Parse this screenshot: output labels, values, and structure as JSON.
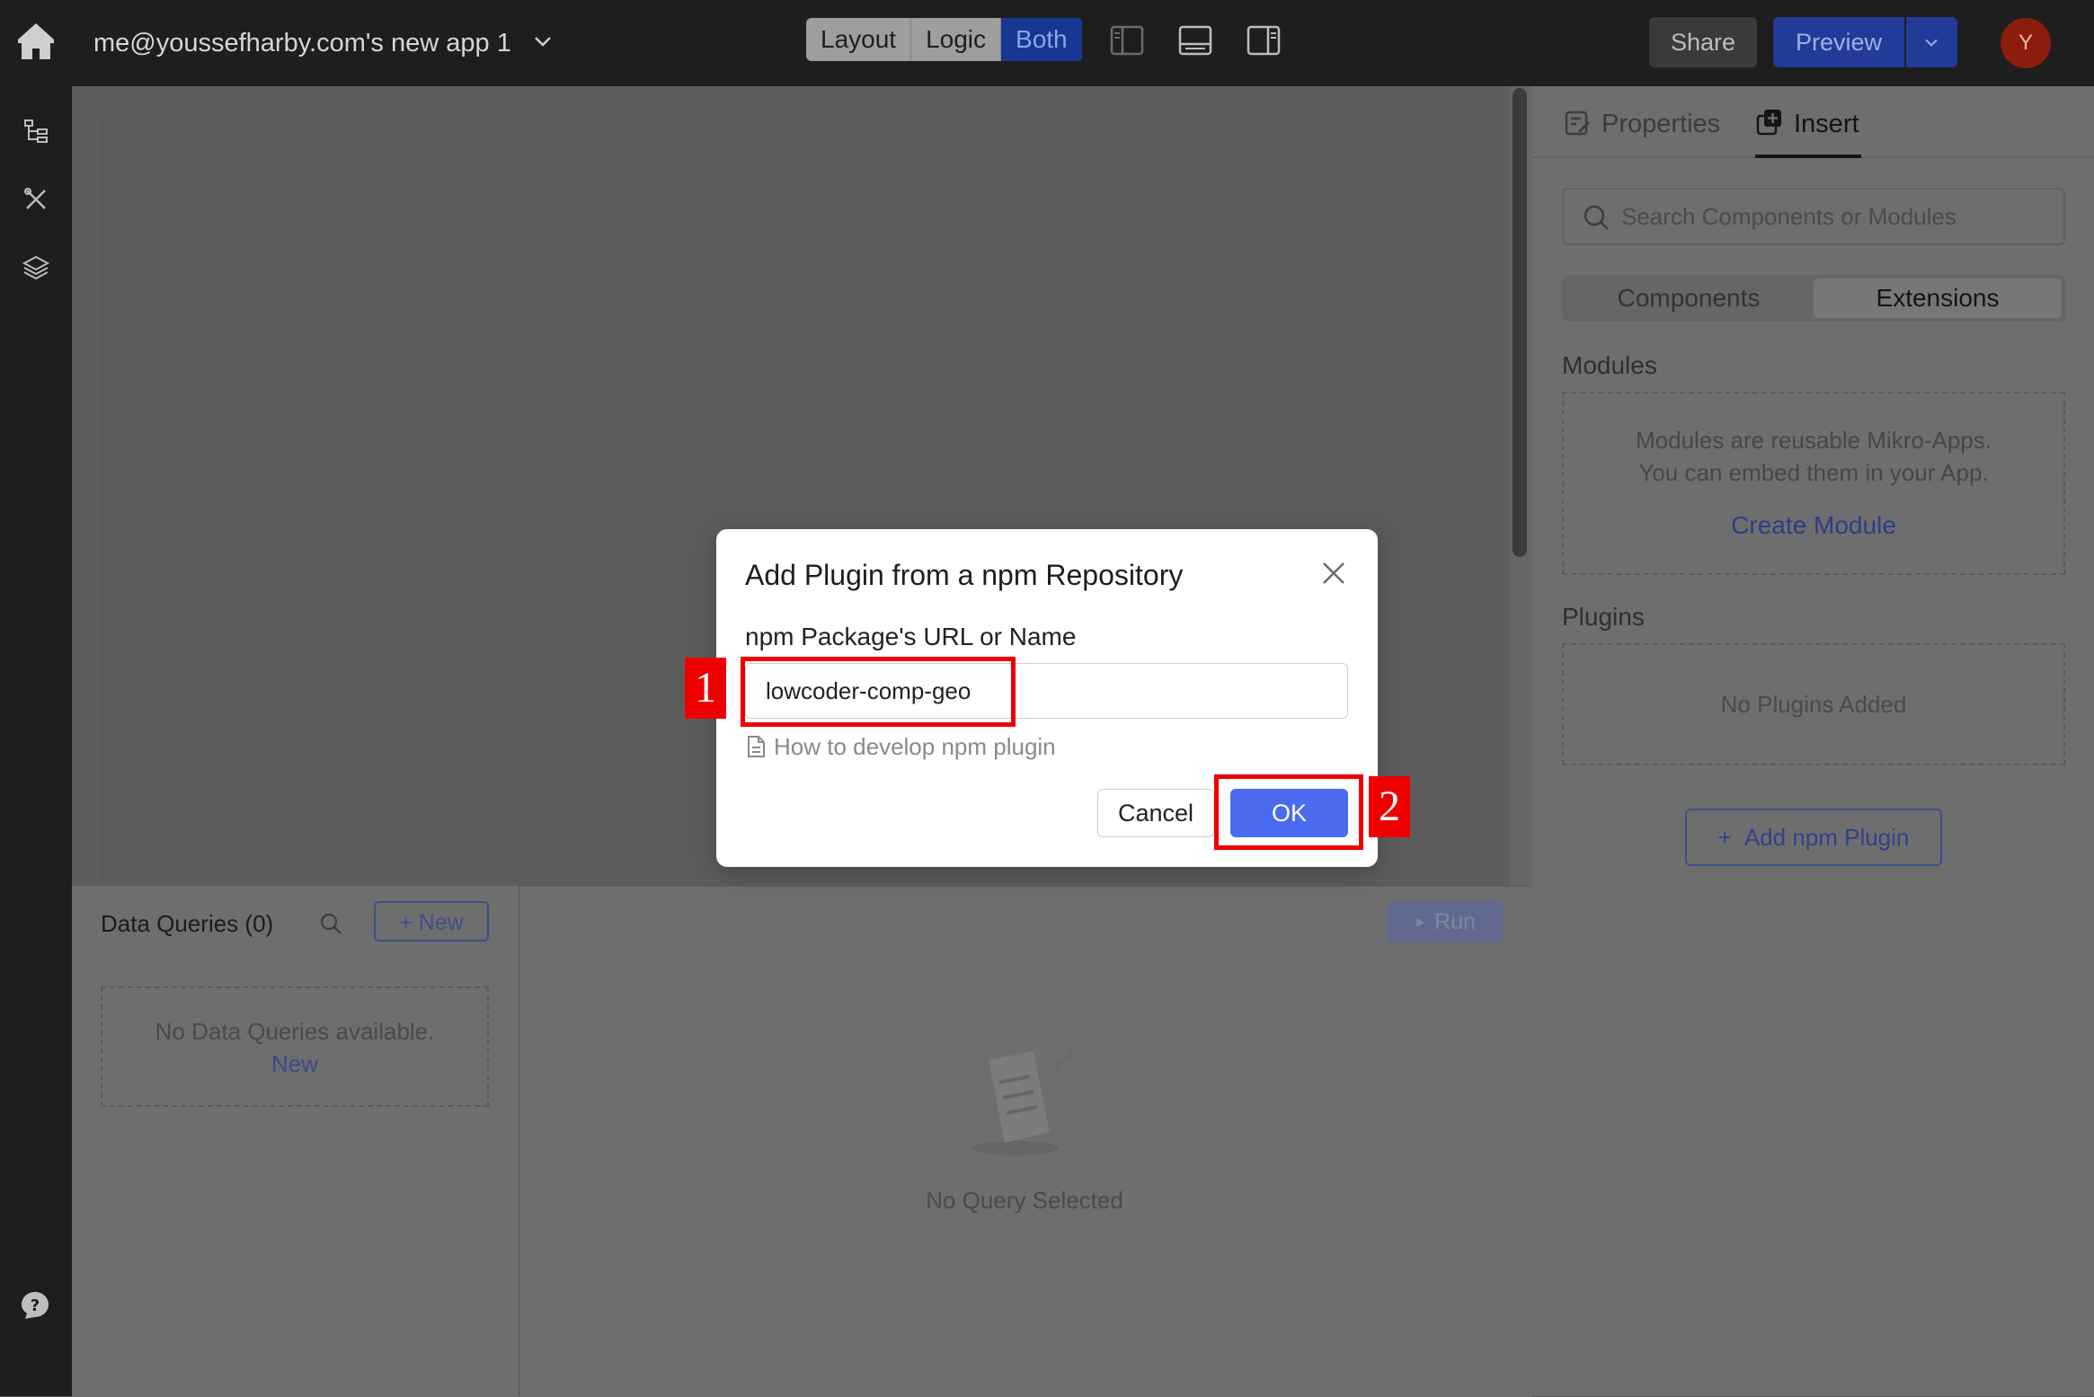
{
  "header": {
    "app_title": "me@youssefharby.com's new app 1",
    "modes": [
      "Layout",
      "Logic",
      "Both"
    ],
    "active_mode": "Both",
    "share_label": "Share",
    "preview_label": "Preview",
    "avatar_initial": "Y"
  },
  "left_sidebar": {
    "icons": [
      "tree-icon",
      "tools-icon",
      "layers-icon"
    ],
    "help_icon": "help-icon"
  },
  "query_panel": {
    "title": "Data Queries (0)",
    "new_button": "+ New",
    "empty_text": "No Data Queries available.",
    "empty_new_link": "New",
    "run_button": "Run",
    "no_query_text": "No Query Selected"
  },
  "right_panel": {
    "tabs": [
      "Properties",
      "Insert"
    ],
    "active_tab": "Insert",
    "search_placeholder": "Search Components or Modules",
    "segments": [
      "Components",
      "Extensions"
    ],
    "active_segment": "Extensions",
    "modules_title": "Modules",
    "modules_desc_line1": "Modules are reusable Mikro-Apps.",
    "modules_desc_line2": "You can embed them in your App.",
    "create_module_link": "Create Module",
    "plugins_title": "Plugins",
    "plugins_empty": "No Plugins Added",
    "add_npm_button": "Add npm Plugin"
  },
  "modal": {
    "title": "Add Plugin from a npm Repository",
    "field_label": "npm Package's URL or Name",
    "input_value": "lowcoder-comp-geo",
    "help_link": "How to develop npm plugin",
    "cancel_label": "Cancel",
    "ok_label": "OK"
  },
  "annotations": {
    "step1": "1",
    "step2": "2",
    "highlight_color": "#ee0000"
  },
  "colors": {
    "primary": "#4a6bf0",
    "topbar": "#1e1e1e"
  }
}
